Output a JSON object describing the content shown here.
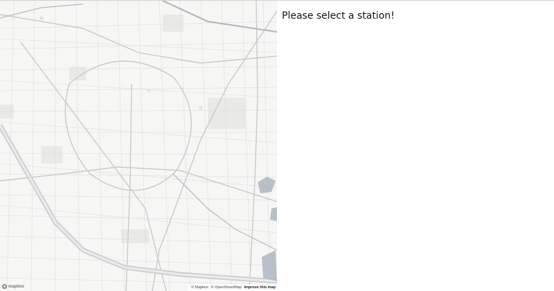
{
  "panel": {
    "title": "Please select a station!"
  },
  "map": {
    "attribution": {
      "mapbox": "© Mapbox",
      "osm": "© OpenStreetMap",
      "improve": "Improve this map"
    },
    "logo_text": "mapbox",
    "colors": {
      "land": "#f6f6f5",
      "road": "#d6d6d6",
      "major_road": "#c9c9c9",
      "block": "#e9e9e8",
      "water": "#aeb6c0",
      "rail": "#b8b8b8",
      "river_channel": "#cfcfcf"
    }
  }
}
